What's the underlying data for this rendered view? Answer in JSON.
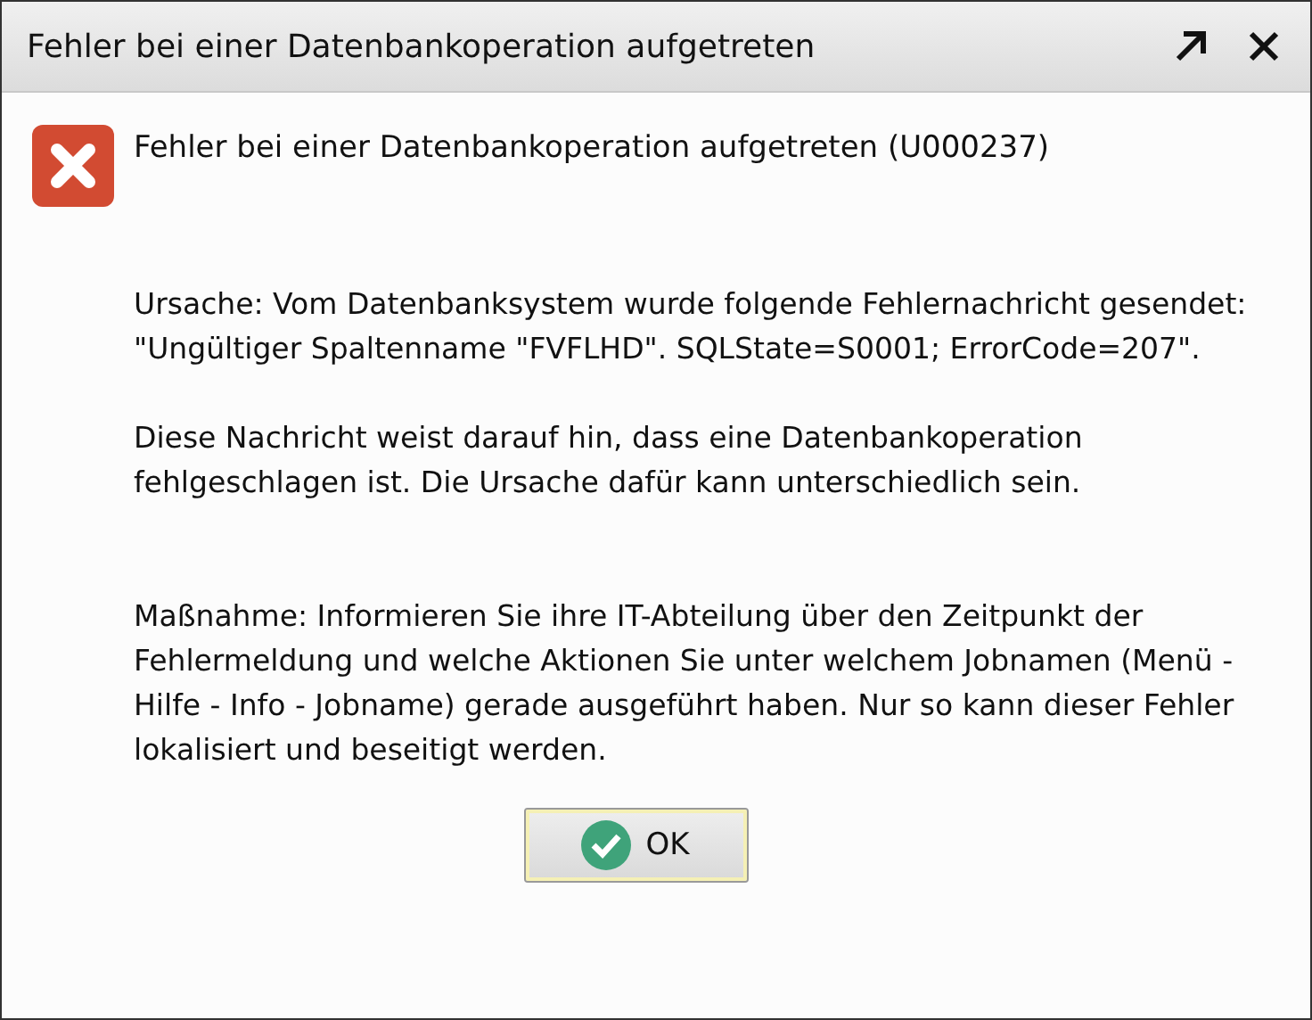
{
  "window": {
    "title": "Fehler bei einer Datenbankoperation aufgetreten"
  },
  "message": {
    "heading": "Fehler bei einer Datenbankoperation aufgetreten (U000237)",
    "paragraphs": [
      "Ursache: Vom Datenbanksystem wurde folgende Fehlernachricht gesendet: \"Ungültiger Spaltenname \"FVFLHD\". SQLState=S0001; ErrorCode=207\".",
      "Diese Nachricht weist darauf hin, dass eine Datenbankoperation fehlgeschlagen ist. Die Ursache dafür kann unterschiedlich sein.",
      "Maßnahme: Informieren Sie ihre IT-Abteilung über den Zeitpunkt der Fehlermeldung und welche Aktionen Sie unter welchem Jobnamen (Menü - Hilfe - Info - Jobname) gerade ausgeführt haben. Nur so kann dieser Fehler lokalisiert und beseitigt werden."
    ]
  },
  "buttons": [
    "OK"
  ]
}
